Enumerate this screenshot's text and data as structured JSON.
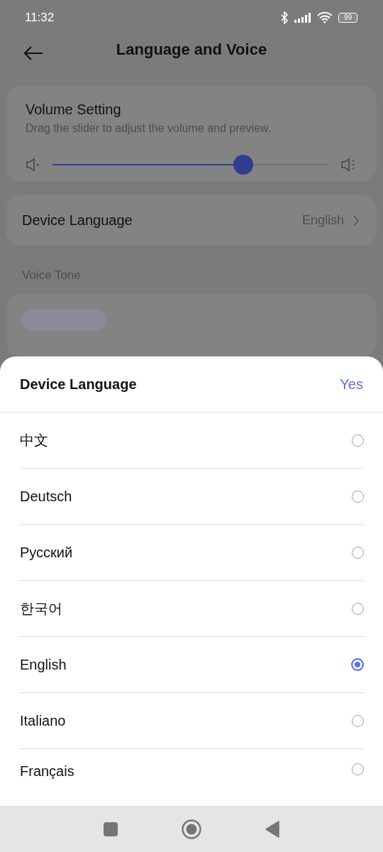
{
  "status_bar": {
    "time": "11:32",
    "battery": "99"
  },
  "header": {
    "title": "Language and Voice"
  },
  "volume": {
    "title": "Volume Setting",
    "description": "Drag the slider to adjust the volume and preview.",
    "level": 0.69
  },
  "device_language": {
    "label": "Device Language",
    "value": "English"
  },
  "voice_tone": {
    "label": "Voice Tone"
  },
  "sheet": {
    "title": "Device Language",
    "confirm": "Yes",
    "options": [
      {
        "label": "中文",
        "selected": false
      },
      {
        "label": "Deutsch",
        "selected": false
      },
      {
        "label": "Русский",
        "selected": false
      },
      {
        "label": "한국어",
        "selected": false
      },
      {
        "label": "English",
        "selected": true
      },
      {
        "label": "Italiano",
        "selected": false
      },
      {
        "label": "Français",
        "selected": false
      }
    ]
  }
}
